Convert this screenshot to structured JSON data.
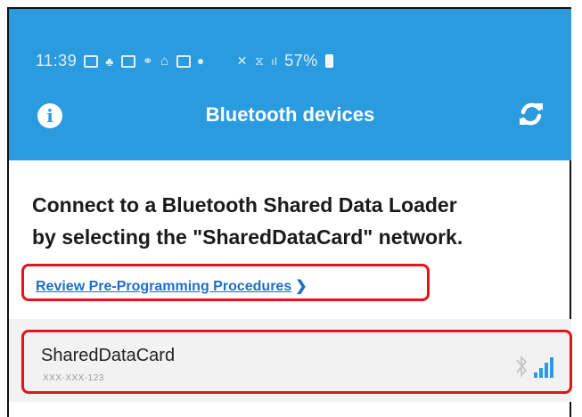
{
  "status_bar": {
    "time": "11:39",
    "battery_percent": "57%"
  },
  "appbar": {
    "title": "Bluetooth devices",
    "left_icon": "info-icon",
    "right_icon": "refresh-icon",
    "color": "#2b9bdf"
  },
  "content": {
    "headline_line1": "Connect to a Bluetooth Shared Data Loader",
    "headline_line2": "by selecting the \"SharedDataCard\" network.",
    "review_link": "Review Pre-Programming Procedures"
  },
  "devices": [
    {
      "name": "SharedDataCard",
      "id": "XXX-XXX-123",
      "icons": [
        "bluetooth-icon",
        "signal-strength-icon"
      ]
    }
  ],
  "highlight_color": "#e3141a",
  "link_color": "#1f6fc6"
}
